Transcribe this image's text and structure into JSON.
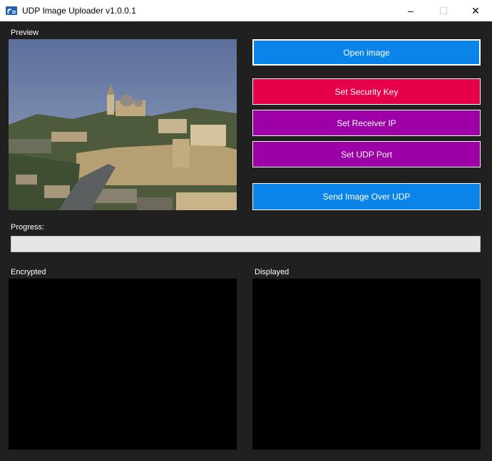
{
  "window": {
    "title": "UDP Image Uploader v1.0.0.1",
    "icon": "udp-signal-app-icon",
    "controls": {
      "minimize": "–",
      "maximize": "☐",
      "close": "✕"
    }
  },
  "preview": {
    "label": "Preview",
    "image": "photo of a hilltop city with stone walls and domed church"
  },
  "buttons": {
    "open_image": "Open image",
    "set_security_key": "Set Security Key",
    "set_receiver_ip": "Set Receiver IP",
    "set_udp_port": "Set UDP Port",
    "send_image": "Send Image Over UDP"
  },
  "progress": {
    "label": "Progress:",
    "value": 0
  },
  "panels": {
    "encrypted_label": "Encrypted",
    "displayed_label": "Displayed"
  },
  "colors": {
    "background": "#202020",
    "blue": "#0a84e9",
    "red": "#e60048",
    "purple": "#9c00a6",
    "panel": "#000000"
  }
}
